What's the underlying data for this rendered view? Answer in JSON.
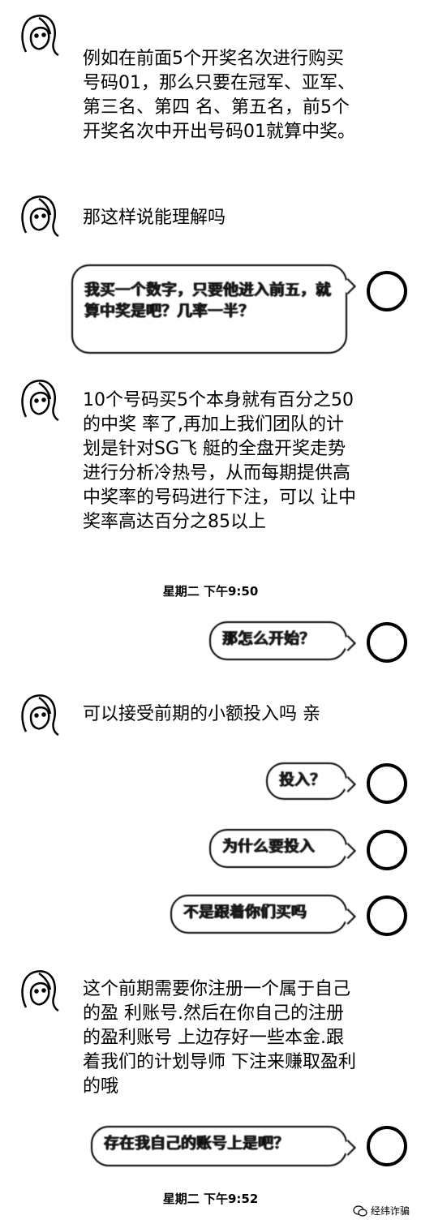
{
  "messages": [
    {
      "side": "left",
      "text": "例如在前面5个开奖名次进行购买号码01，那么只要在冠军、亚军、第三名、第四 名、第五名，前5个开奖名次中开出号码01就算中奖。"
    },
    {
      "side": "left",
      "text": "那这样说能理解吗"
    },
    {
      "side": "right",
      "text": "我买一个数字，只要他进入前五，就算中奖是吧？几率一半？"
    },
    {
      "side": "left",
      "text": "10个号码买5个本身就有百分之50的中奖 率了,再加上我们团队的计划是针对SG飞 艇的全盘开奖走势进行分析冷热号，从而每期提供高中奖率的号码进行下注，可以 让中奖率高达百分之85以上"
    },
    {
      "side": "right",
      "text": "那怎么开始？"
    },
    {
      "side": "left",
      "text": "可以接受前期的小额投入吗 亲"
    },
    {
      "side": "right",
      "text": "投入？"
    },
    {
      "side": "right",
      "text": "为什么要投入"
    },
    {
      "side": "right",
      "text": "不是跟着你们买吗"
    },
    {
      "side": "left",
      "text": "这个前期需要你注册一个属于自己的盈 利账号.然后在你自己的注册的盈利账号 上边存好一些本金.跟着我们的计划导师 下注来赚取盈利的哦"
    },
    {
      "side": "right",
      "text": "存在我自己的账号上是吧？"
    }
  ],
  "timestamps": [
    "星期二 下午9:50",
    "星期二 下午9:52"
  ],
  "watermark": "经纬诈骗"
}
